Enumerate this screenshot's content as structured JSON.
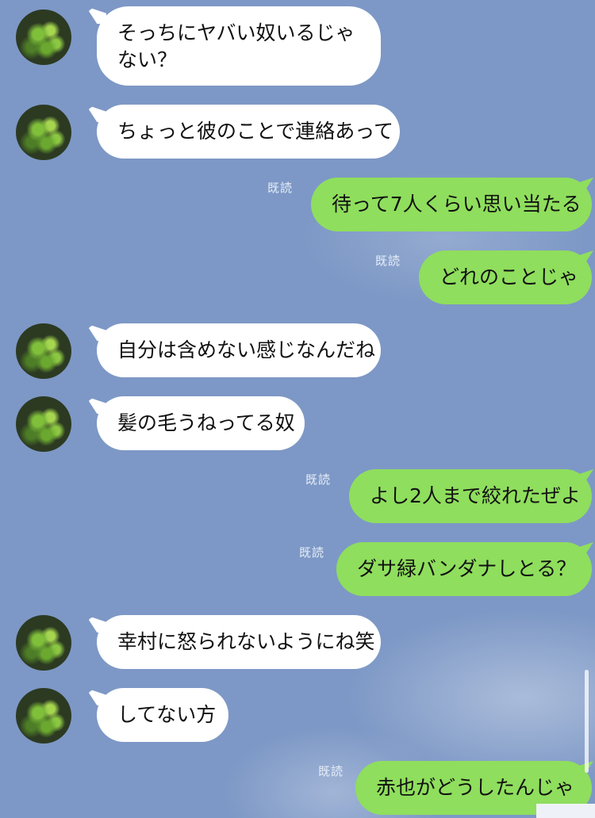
{
  "messages": [
    {
      "side": "in",
      "text": "そっちにヤバい奴いるじゃない？"
    },
    {
      "side": "in",
      "text": "ちょっと彼のことで連絡あって"
    },
    {
      "side": "out",
      "text": "待って7人くらい思い当たる",
      "read": "既読"
    },
    {
      "side": "out",
      "text": "どれのことじゃ",
      "read": "既読"
    },
    {
      "side": "in",
      "text": "自分は含めない感じなんだね"
    },
    {
      "side": "in",
      "text": "髪の毛うねってる奴"
    },
    {
      "side": "out",
      "text": "よし2人まで絞れたぜよ",
      "read": "既読"
    },
    {
      "side": "out",
      "text": "ダサ緑バンダナしとる？",
      "read": "既読"
    },
    {
      "side": "in",
      "text": "幸村に怒られないようにね笑"
    },
    {
      "side": "in",
      "text": "してない方"
    },
    {
      "side": "out",
      "text": "赤也がどうしたんじゃ",
      "read": "既読"
    }
  ],
  "colors": {
    "background": "#7d98c6",
    "incoming_bubble": "#ffffff",
    "outgoing_bubble": "#8fde5d"
  },
  "icons": {
    "contact_avatar": "avatar-photo-green-leaves"
  }
}
